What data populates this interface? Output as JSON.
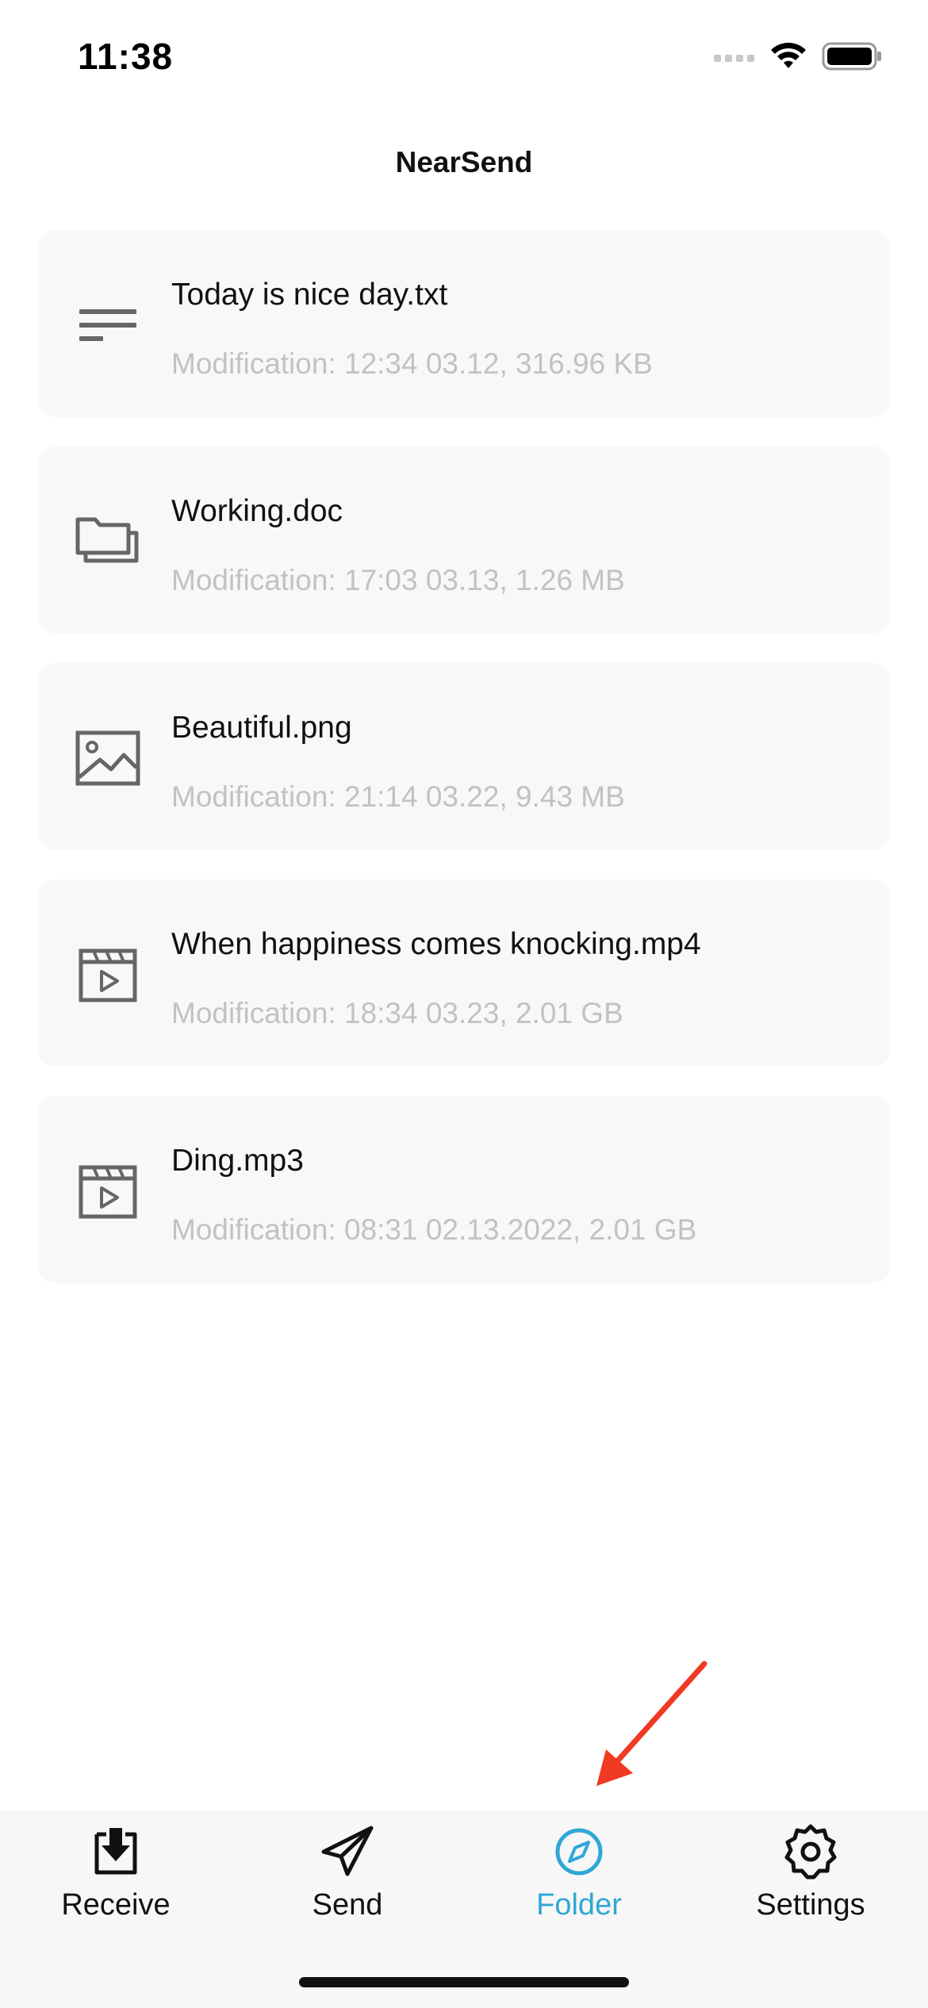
{
  "status_bar": {
    "time": "11:38"
  },
  "app": {
    "title": "NearSend"
  },
  "files": [
    {
      "name": "Today is nice day.txt",
      "meta": "Modification: 12:34 03.12, 316.96 KB",
      "icon": "text-file-icon"
    },
    {
      "name": "Working.doc",
      "meta": "Modification: 17:03 03.13, 1.26 MB",
      "icon": "document-folder-icon"
    },
    {
      "name": "Beautiful.png",
      "meta": "Modification: 21:14 03.22, 9.43 MB",
      "icon": "image-icon"
    },
    {
      "name": "When happiness comes knocking.mp4",
      "meta": "Modification: 18:34 03.23, 2.01 GB",
      "icon": "video-icon"
    },
    {
      "name": "Ding.mp3",
      "meta": "Modification: 08:31 02.13.2022, 2.01 GB",
      "icon": "video-icon"
    }
  ],
  "tabs": [
    {
      "label": "Receive",
      "icon": "receive-icon",
      "active": false
    },
    {
      "label": "Send",
      "icon": "send-icon",
      "active": false
    },
    {
      "label": "Folder",
      "icon": "compass-icon",
      "active": true
    },
    {
      "label": "Settings",
      "icon": "gear-icon",
      "active": false
    }
  ],
  "colors": {
    "accent": "#2ea7d6",
    "card_background": "#f8f8f8",
    "meta_text": "#c2c2c2",
    "annotation_arrow": "#f03a22"
  }
}
